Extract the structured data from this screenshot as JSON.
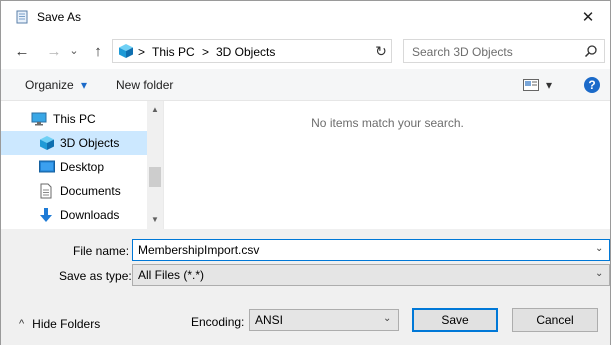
{
  "window": {
    "title": "Save As",
    "close_glyph": "✕"
  },
  "nav": {
    "back_glyph": "←",
    "forward_glyph": "→",
    "recent_glyph": "⌄",
    "up_glyph": "↑",
    "breadcrumbs": [
      "This PC",
      "3D Objects"
    ],
    "crumb_separator": ">",
    "refresh_glyph": "↻",
    "history_glyph": "⌄"
  },
  "search": {
    "placeholder": "Search 3D Objects",
    "icon": "search-icon"
  },
  "toolbar": {
    "organize_label": "Organize",
    "organize_arrow": "▾",
    "new_folder_label": "New folder",
    "view_arrow": "▾",
    "help_glyph": "?"
  },
  "sidebar": {
    "items": [
      {
        "label": "This PC",
        "icon": "this-pc-icon",
        "selected": false,
        "indent": 0
      },
      {
        "label": "3D Objects",
        "icon": "3d-objects-icon",
        "selected": true,
        "indent": 1
      },
      {
        "label": "Desktop",
        "icon": "desktop-icon",
        "selected": false,
        "indent": 1
      },
      {
        "label": "Documents",
        "icon": "documents-icon",
        "selected": false,
        "indent": 1
      },
      {
        "label": "Downloads",
        "icon": "downloads-icon",
        "selected": false,
        "indent": 1
      }
    ],
    "scroll_up": "▲",
    "scroll_down": "▼"
  },
  "content": {
    "empty_message": "No items match your search."
  },
  "form": {
    "file_name_label": "File name:",
    "file_name_value": "MembershipImport.csv",
    "save_as_type_label": "Save as type:",
    "save_as_type_value": "All Files  (*.*)",
    "dropdown_arrow": "⌄"
  },
  "footer": {
    "hide_folders_glyph": "^",
    "hide_folders_label": "Hide Folders",
    "encoding_label": "Encoding:",
    "encoding_value": "ANSI",
    "encoding_arrow": "⌄",
    "save_label": "Save",
    "cancel_label": "Cancel"
  },
  "colors": {
    "accent": "#0078d7",
    "selected_bg": "#cce8ff",
    "help_blue": "#1b6ac9",
    "folder_cyan": "#2ab0e8"
  }
}
